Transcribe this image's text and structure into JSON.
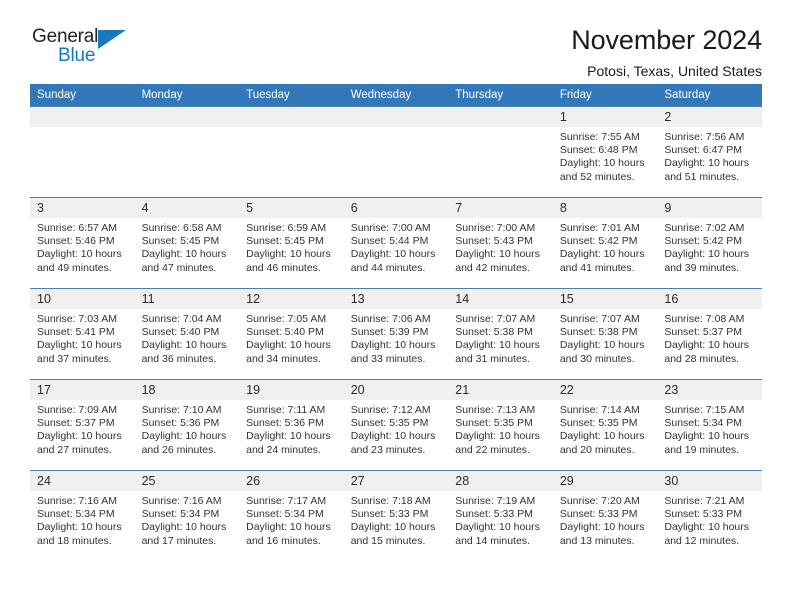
{
  "brand": {
    "name_part1": "General",
    "name_part2": "Blue",
    "triangle_icon": "blue-triangle-logo-mark",
    "colors": {
      "dark": "#231f20",
      "blue": "#1878be"
    }
  },
  "header": {
    "title": "November 2024",
    "subtitle": "Potosi, Texas, United States"
  },
  "theme": {
    "header_blue": "#3278b9",
    "daynum_gray": "#f0f0f0",
    "row_divider": "#4a7fae"
  },
  "calendar": {
    "weekday_headers": [
      "Sunday",
      "Monday",
      "Tuesday",
      "Wednesday",
      "Thursday",
      "Friday",
      "Saturday"
    ],
    "labels": {
      "sunrise": "Sunrise:",
      "sunset": "Sunset:",
      "daylight": "Daylight:"
    },
    "weeks": [
      [
        {
          "day": "",
          "empty": true
        },
        {
          "day": "",
          "empty": true
        },
        {
          "day": "",
          "empty": true
        },
        {
          "day": "",
          "empty": true
        },
        {
          "day": "",
          "empty": true
        },
        {
          "day": "1",
          "sunrise": "Sunrise: 7:55 AM",
          "sunset": "Sunset: 6:48 PM",
          "daylight_l1": "Daylight: 10 hours",
          "daylight_l2": "and 52 minutes."
        },
        {
          "day": "2",
          "sunrise": "Sunrise: 7:56 AM",
          "sunset": "Sunset: 6:47 PM",
          "daylight_l1": "Daylight: 10 hours",
          "daylight_l2": "and 51 minutes."
        }
      ],
      [
        {
          "day": "3",
          "sunrise": "Sunrise: 6:57 AM",
          "sunset": "Sunset: 5:46 PM",
          "daylight_l1": "Daylight: 10 hours",
          "daylight_l2": "and 49 minutes."
        },
        {
          "day": "4",
          "sunrise": "Sunrise: 6:58 AM",
          "sunset": "Sunset: 5:45 PM",
          "daylight_l1": "Daylight: 10 hours",
          "daylight_l2": "and 47 minutes."
        },
        {
          "day": "5",
          "sunrise": "Sunrise: 6:59 AM",
          "sunset": "Sunset: 5:45 PM",
          "daylight_l1": "Daylight: 10 hours",
          "daylight_l2": "and 46 minutes."
        },
        {
          "day": "6",
          "sunrise": "Sunrise: 7:00 AM",
          "sunset": "Sunset: 5:44 PM",
          "daylight_l1": "Daylight: 10 hours",
          "daylight_l2": "and 44 minutes."
        },
        {
          "day": "7",
          "sunrise": "Sunrise: 7:00 AM",
          "sunset": "Sunset: 5:43 PM",
          "daylight_l1": "Daylight: 10 hours",
          "daylight_l2": "and 42 minutes."
        },
        {
          "day": "8",
          "sunrise": "Sunrise: 7:01 AM",
          "sunset": "Sunset: 5:42 PM",
          "daylight_l1": "Daylight: 10 hours",
          "daylight_l2": "and 41 minutes."
        },
        {
          "day": "9",
          "sunrise": "Sunrise: 7:02 AM",
          "sunset": "Sunset: 5:42 PM",
          "daylight_l1": "Daylight: 10 hours",
          "daylight_l2": "and 39 minutes."
        }
      ],
      [
        {
          "day": "10",
          "sunrise": "Sunrise: 7:03 AM",
          "sunset": "Sunset: 5:41 PM",
          "daylight_l1": "Daylight: 10 hours",
          "daylight_l2": "and 37 minutes."
        },
        {
          "day": "11",
          "sunrise": "Sunrise: 7:04 AM",
          "sunset": "Sunset: 5:40 PM",
          "daylight_l1": "Daylight: 10 hours",
          "daylight_l2": "and 36 minutes."
        },
        {
          "day": "12",
          "sunrise": "Sunrise: 7:05 AM",
          "sunset": "Sunset: 5:40 PM",
          "daylight_l1": "Daylight: 10 hours",
          "daylight_l2": "and 34 minutes."
        },
        {
          "day": "13",
          "sunrise": "Sunrise: 7:06 AM",
          "sunset": "Sunset: 5:39 PM",
          "daylight_l1": "Daylight: 10 hours",
          "daylight_l2": "and 33 minutes."
        },
        {
          "day": "14",
          "sunrise": "Sunrise: 7:07 AM",
          "sunset": "Sunset: 5:38 PM",
          "daylight_l1": "Daylight: 10 hours",
          "daylight_l2": "and 31 minutes."
        },
        {
          "day": "15",
          "sunrise": "Sunrise: 7:07 AM",
          "sunset": "Sunset: 5:38 PM",
          "daylight_l1": "Daylight: 10 hours",
          "daylight_l2": "and 30 minutes."
        },
        {
          "day": "16",
          "sunrise": "Sunrise: 7:08 AM",
          "sunset": "Sunset: 5:37 PM",
          "daylight_l1": "Daylight: 10 hours",
          "daylight_l2": "and 28 minutes."
        }
      ],
      [
        {
          "day": "17",
          "sunrise": "Sunrise: 7:09 AM",
          "sunset": "Sunset: 5:37 PM",
          "daylight_l1": "Daylight: 10 hours",
          "daylight_l2": "and 27 minutes."
        },
        {
          "day": "18",
          "sunrise": "Sunrise: 7:10 AM",
          "sunset": "Sunset: 5:36 PM",
          "daylight_l1": "Daylight: 10 hours",
          "daylight_l2": "and 26 minutes."
        },
        {
          "day": "19",
          "sunrise": "Sunrise: 7:11 AM",
          "sunset": "Sunset: 5:36 PM",
          "daylight_l1": "Daylight: 10 hours",
          "daylight_l2": "and 24 minutes."
        },
        {
          "day": "20",
          "sunrise": "Sunrise: 7:12 AM",
          "sunset": "Sunset: 5:35 PM",
          "daylight_l1": "Daylight: 10 hours",
          "daylight_l2": "and 23 minutes."
        },
        {
          "day": "21",
          "sunrise": "Sunrise: 7:13 AM",
          "sunset": "Sunset: 5:35 PM",
          "daylight_l1": "Daylight: 10 hours",
          "daylight_l2": "and 22 minutes."
        },
        {
          "day": "22",
          "sunrise": "Sunrise: 7:14 AM",
          "sunset": "Sunset: 5:35 PM",
          "daylight_l1": "Daylight: 10 hours",
          "daylight_l2": "and 20 minutes."
        },
        {
          "day": "23",
          "sunrise": "Sunrise: 7:15 AM",
          "sunset": "Sunset: 5:34 PM",
          "daylight_l1": "Daylight: 10 hours",
          "daylight_l2": "and 19 minutes."
        }
      ],
      [
        {
          "day": "24",
          "sunrise": "Sunrise: 7:16 AM",
          "sunset": "Sunset: 5:34 PM",
          "daylight_l1": "Daylight: 10 hours",
          "daylight_l2": "and 18 minutes."
        },
        {
          "day": "25",
          "sunrise": "Sunrise: 7:16 AM",
          "sunset": "Sunset: 5:34 PM",
          "daylight_l1": "Daylight: 10 hours",
          "daylight_l2": "and 17 minutes."
        },
        {
          "day": "26",
          "sunrise": "Sunrise: 7:17 AM",
          "sunset": "Sunset: 5:34 PM",
          "daylight_l1": "Daylight: 10 hours",
          "daylight_l2": "and 16 minutes."
        },
        {
          "day": "27",
          "sunrise": "Sunrise: 7:18 AM",
          "sunset": "Sunset: 5:33 PM",
          "daylight_l1": "Daylight: 10 hours",
          "daylight_l2": "and 15 minutes."
        },
        {
          "day": "28",
          "sunrise": "Sunrise: 7:19 AM",
          "sunset": "Sunset: 5:33 PM",
          "daylight_l1": "Daylight: 10 hours",
          "daylight_l2": "and 14 minutes."
        },
        {
          "day": "29",
          "sunrise": "Sunrise: 7:20 AM",
          "sunset": "Sunset: 5:33 PM",
          "daylight_l1": "Daylight: 10 hours",
          "daylight_l2": "and 13 minutes."
        },
        {
          "day": "30",
          "sunrise": "Sunrise: 7:21 AM",
          "sunset": "Sunset: 5:33 PM",
          "daylight_l1": "Daylight: 10 hours",
          "daylight_l2": "and 12 minutes."
        }
      ]
    ]
  }
}
